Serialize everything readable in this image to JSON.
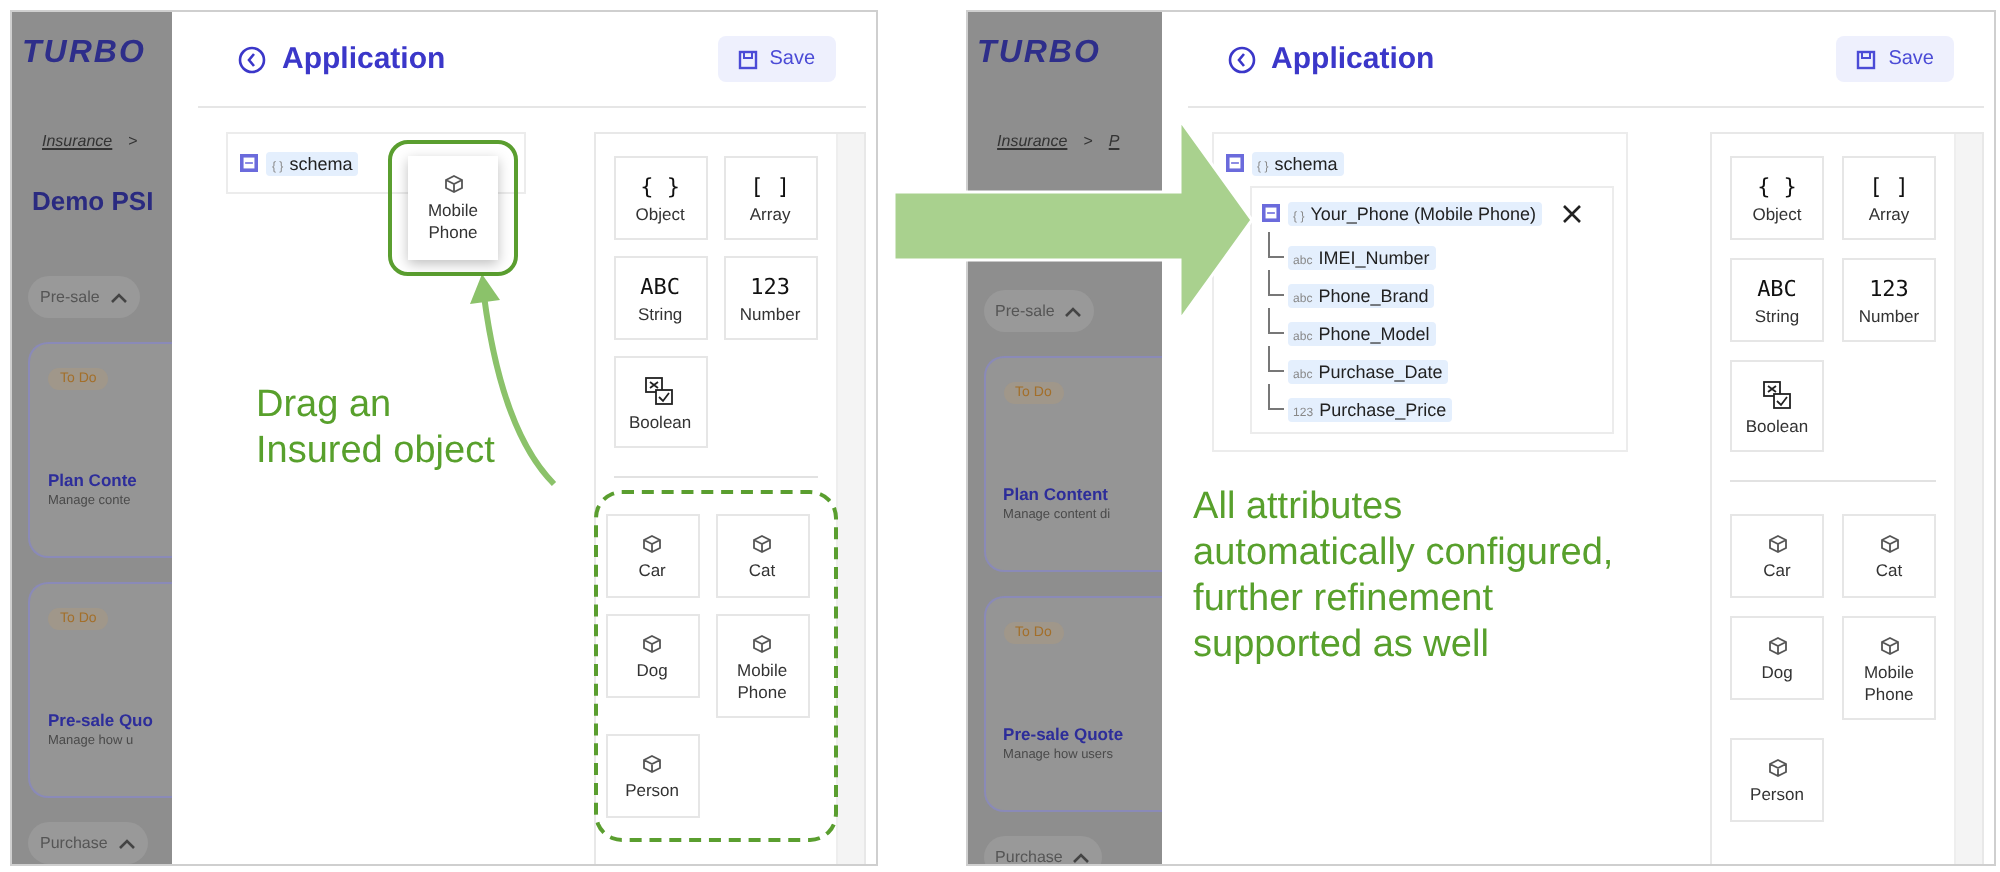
{
  "panels": [
    {
      "background": {
        "logo": "TURBO",
        "breadcrumb": [
          {
            "kind": "link",
            "text": "Insurance"
          },
          {
            "kind": "separator",
            "text": ">"
          }
        ],
        "page_title": "Demo PSI",
        "sections": [
          {
            "kind": "pill",
            "label": "Pre-sale"
          },
          {
            "kind": "card",
            "status": "To Do",
            "title": "Plan Conte",
            "description": "Manage conte"
          },
          {
            "kind": "card",
            "status": "To Do",
            "title": "Pre-sale Quo",
            "description": "Manage how u"
          },
          {
            "kind": "pill",
            "label": "Purchase"
          }
        ]
      },
      "drawer": {
        "title": "Application",
        "save_label": "Save",
        "tree": {
          "label": "schema",
          "badge": "{ }",
          "expanded": true
        },
        "drag_ghost": {
          "label": "Mobile Phone",
          "highlighted": true
        },
        "palette": [
          {
            "highlighted": false,
            "items": [
              {
                "kind": "glyph",
                "glyph": "{ }",
                "label": "Object"
              },
              {
                "kind": "glyph",
                "glyph": "[ ]",
                "label": "Array"
              },
              {
                "kind": "glyph",
                "glyph": "ABC",
                "label": "String"
              },
              {
                "kind": "glyph",
                "glyph": "123",
                "label": "Number"
              },
              {
                "kind": "boolean",
                "label": "Boolean"
              }
            ]
          },
          {
            "highlighted": true,
            "items": [
              {
                "kind": "object",
                "label": "Car"
              },
              {
                "kind": "object",
                "label": "Cat"
              },
              {
                "kind": "object",
                "label": "Dog"
              },
              {
                "kind": "object",
                "label": "Mobile Phone"
              },
              {
                "kind": "object",
                "label": "Person"
              }
            ]
          }
        ],
        "annotation": "Drag an\nInsured object"
      }
    },
    {
      "background": {
        "logo": "TURBO",
        "breadcrumb": [
          {
            "kind": "link",
            "text": "Insurance"
          },
          {
            "kind": "separator",
            "text": ">"
          },
          {
            "kind": "link",
            "text": "P"
          }
        ],
        "sections": [
          {
            "kind": "pill",
            "label": "Pre-sale"
          },
          {
            "kind": "card",
            "status": "To Do",
            "title": "Plan Content",
            "description": "Manage content di"
          },
          {
            "kind": "card",
            "status": "To Do",
            "title": "Pre-sale Quote",
            "description": "Manage how users"
          },
          {
            "kind": "pill",
            "label": "Purchase"
          }
        ]
      },
      "drawer": {
        "title": "Application",
        "save_label": "Save",
        "tree": {
          "label": "schema",
          "badge": "{ }",
          "expanded": true,
          "children": [
            {
              "label": "Your_Phone (Mobile Phone)",
              "badge": "{ }",
              "expanded": true,
              "removable": true,
              "children": [
                {
                  "label": "IMEI_Number",
                  "badge": "abc"
                },
                {
                  "label": "Phone_Brand",
                  "badge": "abc"
                },
                {
                  "label": "Phone_Model",
                  "badge": "abc"
                },
                {
                  "label": "Purchase_Date",
                  "badge": "abc"
                },
                {
                  "label": "Purchase_Price",
                  "badge": "123"
                }
              ]
            }
          ]
        },
        "palette": [
          {
            "highlighted": false,
            "items": [
              {
                "kind": "glyph",
                "glyph": "{ }",
                "label": "Object"
              },
              {
                "kind": "glyph",
                "glyph": "[ ]",
                "label": "Array"
              },
              {
                "kind": "glyph",
                "glyph": "ABC",
                "label": "String"
              },
              {
                "kind": "glyph",
                "glyph": "123",
                "label": "Number"
              },
              {
                "kind": "boolean",
                "label": "Boolean"
              }
            ]
          },
          {
            "highlighted": false,
            "items": [
              {
                "kind": "object",
                "label": "Car"
              },
              {
                "kind": "object",
                "label": "Cat"
              },
              {
                "kind": "object",
                "label": "Dog"
              },
              {
                "kind": "object",
                "label": "Mobile Phone"
              },
              {
                "kind": "object",
                "label": "Person"
              }
            ]
          }
        ],
        "annotation": "All attributes\nautomatically configured,\nfurther refinement\nsupported as well"
      }
    }
  ]
}
